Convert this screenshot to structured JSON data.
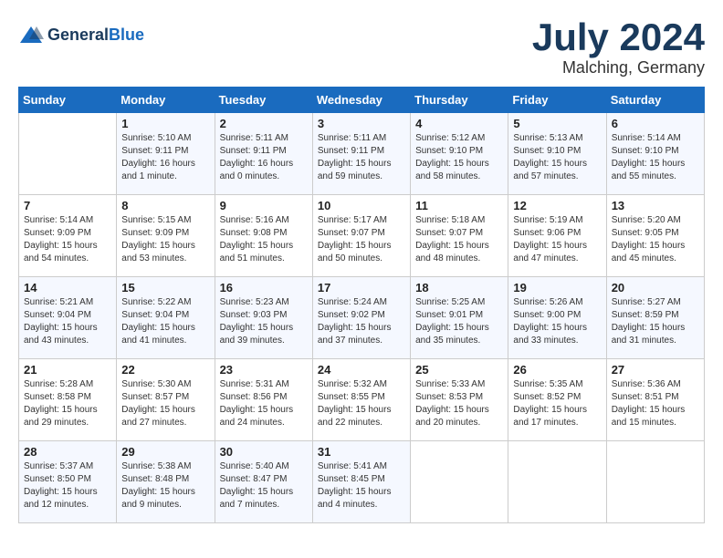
{
  "header": {
    "logo_line1": "General",
    "logo_line2": "Blue",
    "month": "July 2024",
    "location": "Malching, Germany"
  },
  "weekdays": [
    "Sunday",
    "Monday",
    "Tuesday",
    "Wednesday",
    "Thursday",
    "Friday",
    "Saturday"
  ],
  "weeks": [
    [
      {
        "day": "",
        "info": ""
      },
      {
        "day": "1",
        "info": "Sunrise: 5:10 AM\nSunset: 9:11 PM\nDaylight: 16 hours\nand 1 minute."
      },
      {
        "day": "2",
        "info": "Sunrise: 5:11 AM\nSunset: 9:11 PM\nDaylight: 16 hours\nand 0 minutes."
      },
      {
        "day": "3",
        "info": "Sunrise: 5:11 AM\nSunset: 9:11 PM\nDaylight: 15 hours\nand 59 minutes."
      },
      {
        "day": "4",
        "info": "Sunrise: 5:12 AM\nSunset: 9:10 PM\nDaylight: 15 hours\nand 58 minutes."
      },
      {
        "day": "5",
        "info": "Sunrise: 5:13 AM\nSunset: 9:10 PM\nDaylight: 15 hours\nand 57 minutes."
      },
      {
        "day": "6",
        "info": "Sunrise: 5:14 AM\nSunset: 9:10 PM\nDaylight: 15 hours\nand 55 minutes."
      }
    ],
    [
      {
        "day": "7",
        "info": "Sunrise: 5:14 AM\nSunset: 9:09 PM\nDaylight: 15 hours\nand 54 minutes."
      },
      {
        "day": "8",
        "info": "Sunrise: 5:15 AM\nSunset: 9:09 PM\nDaylight: 15 hours\nand 53 minutes."
      },
      {
        "day": "9",
        "info": "Sunrise: 5:16 AM\nSunset: 9:08 PM\nDaylight: 15 hours\nand 51 minutes."
      },
      {
        "day": "10",
        "info": "Sunrise: 5:17 AM\nSunset: 9:07 PM\nDaylight: 15 hours\nand 50 minutes."
      },
      {
        "day": "11",
        "info": "Sunrise: 5:18 AM\nSunset: 9:07 PM\nDaylight: 15 hours\nand 48 minutes."
      },
      {
        "day": "12",
        "info": "Sunrise: 5:19 AM\nSunset: 9:06 PM\nDaylight: 15 hours\nand 47 minutes."
      },
      {
        "day": "13",
        "info": "Sunrise: 5:20 AM\nSunset: 9:05 PM\nDaylight: 15 hours\nand 45 minutes."
      }
    ],
    [
      {
        "day": "14",
        "info": "Sunrise: 5:21 AM\nSunset: 9:04 PM\nDaylight: 15 hours\nand 43 minutes."
      },
      {
        "day": "15",
        "info": "Sunrise: 5:22 AM\nSunset: 9:04 PM\nDaylight: 15 hours\nand 41 minutes."
      },
      {
        "day": "16",
        "info": "Sunrise: 5:23 AM\nSunset: 9:03 PM\nDaylight: 15 hours\nand 39 minutes."
      },
      {
        "day": "17",
        "info": "Sunrise: 5:24 AM\nSunset: 9:02 PM\nDaylight: 15 hours\nand 37 minutes."
      },
      {
        "day": "18",
        "info": "Sunrise: 5:25 AM\nSunset: 9:01 PM\nDaylight: 15 hours\nand 35 minutes."
      },
      {
        "day": "19",
        "info": "Sunrise: 5:26 AM\nSunset: 9:00 PM\nDaylight: 15 hours\nand 33 minutes."
      },
      {
        "day": "20",
        "info": "Sunrise: 5:27 AM\nSunset: 8:59 PM\nDaylight: 15 hours\nand 31 minutes."
      }
    ],
    [
      {
        "day": "21",
        "info": "Sunrise: 5:28 AM\nSunset: 8:58 PM\nDaylight: 15 hours\nand 29 minutes."
      },
      {
        "day": "22",
        "info": "Sunrise: 5:30 AM\nSunset: 8:57 PM\nDaylight: 15 hours\nand 27 minutes."
      },
      {
        "day": "23",
        "info": "Sunrise: 5:31 AM\nSunset: 8:56 PM\nDaylight: 15 hours\nand 24 minutes."
      },
      {
        "day": "24",
        "info": "Sunrise: 5:32 AM\nSunset: 8:55 PM\nDaylight: 15 hours\nand 22 minutes."
      },
      {
        "day": "25",
        "info": "Sunrise: 5:33 AM\nSunset: 8:53 PM\nDaylight: 15 hours\nand 20 minutes."
      },
      {
        "day": "26",
        "info": "Sunrise: 5:35 AM\nSunset: 8:52 PM\nDaylight: 15 hours\nand 17 minutes."
      },
      {
        "day": "27",
        "info": "Sunrise: 5:36 AM\nSunset: 8:51 PM\nDaylight: 15 hours\nand 15 minutes."
      }
    ],
    [
      {
        "day": "28",
        "info": "Sunrise: 5:37 AM\nSunset: 8:50 PM\nDaylight: 15 hours\nand 12 minutes."
      },
      {
        "day": "29",
        "info": "Sunrise: 5:38 AM\nSunset: 8:48 PM\nDaylight: 15 hours\nand 9 minutes."
      },
      {
        "day": "30",
        "info": "Sunrise: 5:40 AM\nSunset: 8:47 PM\nDaylight: 15 hours\nand 7 minutes."
      },
      {
        "day": "31",
        "info": "Sunrise: 5:41 AM\nSunset: 8:45 PM\nDaylight: 15 hours\nand 4 minutes."
      },
      {
        "day": "",
        "info": ""
      },
      {
        "day": "",
        "info": ""
      },
      {
        "day": "",
        "info": ""
      }
    ]
  ]
}
